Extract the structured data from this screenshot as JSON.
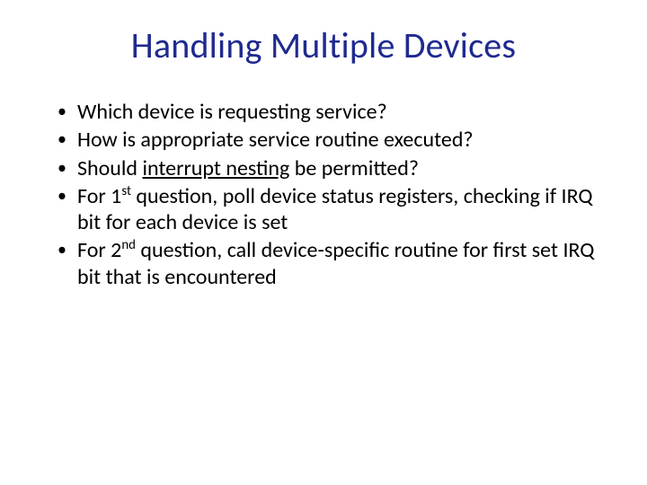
{
  "title": "Handling Multiple Devices",
  "bullets": {
    "b1": "Which device is requesting service?",
    "b2": "How is appropriate service routine executed?",
    "b3_pre": "Should ",
    "b3_u": "interrupt nesting",
    "b3_post": " be permitted?",
    "b4_pre": "For 1",
    "b4_sup": "st",
    "b4_mid": " question, poll device status registers, checking if IRQ bit for each device is set",
    "b5_pre": "For 2",
    "b5_sup": "nd",
    "b5_mid": " question, call device-specific routine  for first set IRQ bit that is encountered"
  }
}
